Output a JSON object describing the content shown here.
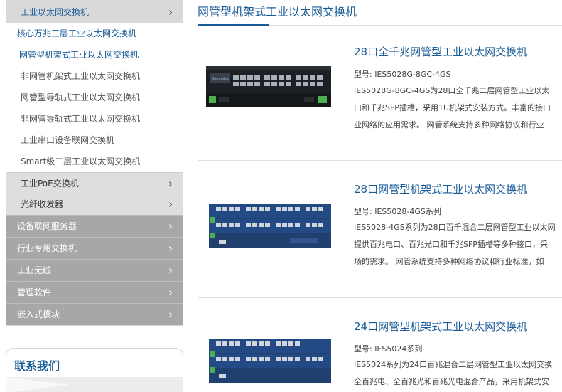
{
  "sidebar": {
    "expanded_item": "工业以太网交换机",
    "sub_items": [
      "核心万兆三层工业以太网交换机",
      "网管型机架式工业以太网交换机",
      "非网管机架式工业以太网交换机",
      "网管型导轨式工业以太网交换机",
      "非网管导轨式工业以太网交换机",
      "工业串口设备联网交换机",
      "Smart级二层工业以太网交换机"
    ],
    "mid_items": [
      "工业PoE交换机",
      "光纤收发器"
    ],
    "categories": [
      "设备联网服务器",
      "行业专用交换机",
      "工业无线",
      "管理软件",
      "嵌入式模块"
    ],
    "chevron": "chevron-right-icon"
  },
  "contact": {
    "title": "联系我们"
  },
  "main": {
    "page_title": "网管型机架式工业以太网交换机",
    "products": [
      {
        "name": "28口全千兆网管型工业以太网交换机",
        "model": "型号: IES5028G-8GC-4GS",
        "desc": [
          "IES5028G-8GC-4GS为28口全千兆二层网管型工业以太",
          "口和千兆SFP插槽，采用1U机架式安装方式。丰富的接口",
          "业网络的应用需求。  网管系统支持多种网络协议和行业"
        ]
      },
      {
        "name": "28口网管型机架式工业以太网交换机",
        "model": "型号: IES5028-4GS系列",
        "desc": [
          "IES5028-4GS系列为28口百千混合二层网管型工业以太网",
          "提供百兆电口、百兆光口和千兆SFP插槽等多种接口，采",
          "场的需求。  网管系统支持多种网络协议和行业标准，如"
        ]
      },
      {
        "name": "24口网管型机架式工业以太网交换机",
        "model": "型号: IES5024系列",
        "desc": [
          "IES5024系列为24口百兆混合二层网管型工业以太网交换",
          "全百兆电、全百兆光和百兆光电混合产品，采用机架式安"
        ]
      }
    ]
  },
  "colors": {
    "accent": "#1a5c98",
    "sidebar_dark": "#a7a7a7",
    "sidebar_mid": "#dedede"
  }
}
